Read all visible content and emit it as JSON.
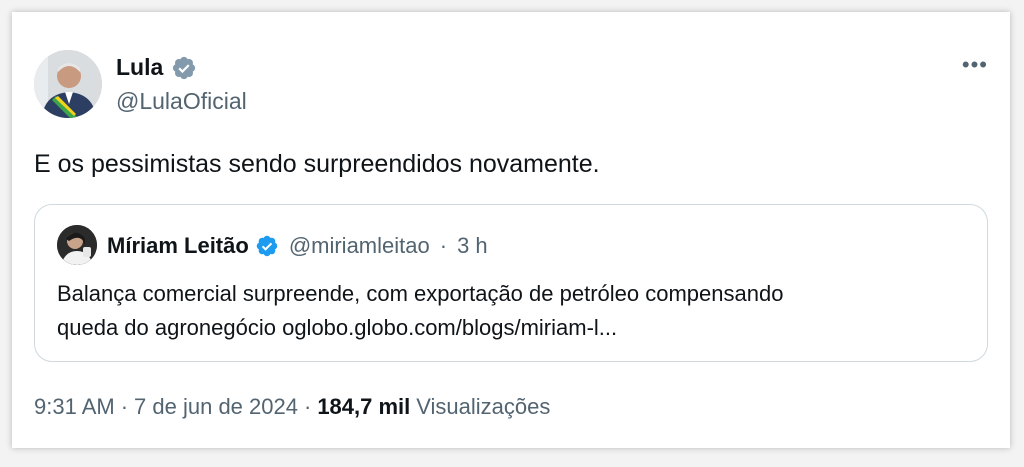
{
  "author": {
    "name": "Lula",
    "handle": "@LulaOficial",
    "verified_color": "#829aab"
  },
  "tweet": {
    "text": "E os pessimistas sendo surpreendidos novamente.",
    "more_label": "•••"
  },
  "quote": {
    "name": "Míriam Leitão",
    "handle": "@miriamleitao",
    "sep": "·",
    "time": "3 h",
    "line1": "Balança comercial surpreende, com exportação de petróleo compensando",
    "line2": "queda do agronegócio oglobo.globo.com/blogs/miriam-l...",
    "verified_color": "#1d9bf0"
  },
  "footer": {
    "time": "9:31 AM",
    "sep1": "·",
    "date": "7 de jun de 2024",
    "sep2": "·",
    "views_count": "184,7 mil",
    "views_label": "Visualizações"
  }
}
